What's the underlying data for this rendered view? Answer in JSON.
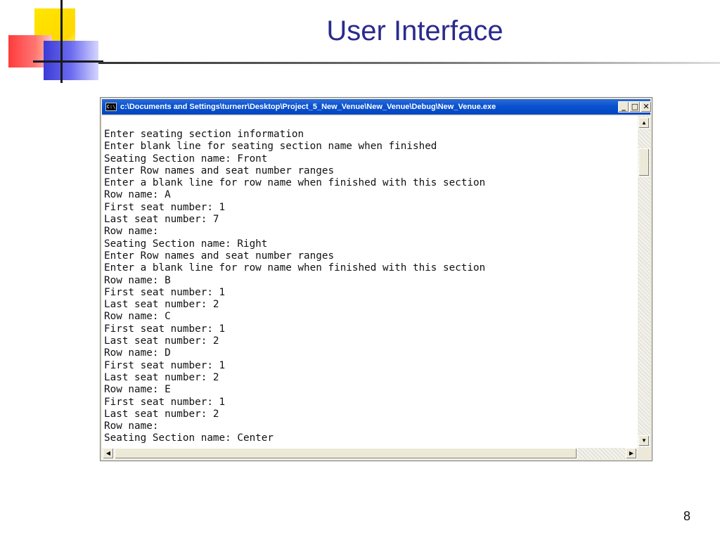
{
  "slide": {
    "title": "User Interface",
    "page_number": "8"
  },
  "window": {
    "icon_label": "C:\\",
    "title": "c:\\Documents and Settings\\turnerr\\Desktop\\Project_5_New_Venue\\New_Venue\\Debug\\New_Venue.exe",
    "minimize_glyph": "_",
    "maximize_glyph": "□",
    "close_glyph": "✕"
  },
  "console_lines": [
    "Enter seating section information",
    "Enter blank line for seating section name when finished",
    "Seating Section name: Front",
    "Enter Row names and seat number ranges",
    "Enter a blank line for row name when finished with this section",
    "Row name: A",
    "First seat number: 1",
    "Last seat number: 7",
    "Row name:",
    "Seating Section name: Right",
    "Enter Row names and seat number ranges",
    "Enter a blank line for row name when finished with this section",
    "Row name: B",
    "First seat number: 1",
    "Last seat number: 2",
    "Row name: C",
    "First seat number: 1",
    "Last seat number: 2",
    "Row name: D",
    "First seat number: 1",
    "Last seat number: 2",
    "Row name: E",
    "First seat number: 1",
    "Last seat number: 2",
    "Row name:",
    "Seating Section name: Center"
  ],
  "scrollbar": {
    "up_arrow": "▲",
    "down_arrow": "▼",
    "left_arrow": "◀",
    "right_arrow": "▶"
  }
}
